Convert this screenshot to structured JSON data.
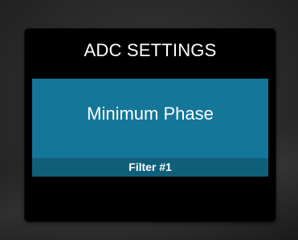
{
  "screen": {
    "title": "ADC SETTINGS",
    "setting": {
      "value": "Minimum Phase",
      "label": "Filter #1"
    }
  },
  "colors": {
    "panel": "#147699",
    "panel_footer": "#0f5f7a",
    "screen_bg": "#000000",
    "text": "#ffffff"
  }
}
